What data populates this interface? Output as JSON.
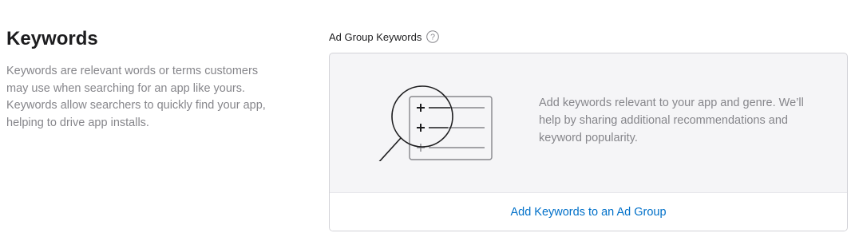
{
  "section": {
    "title": "Keywords",
    "description": "Keywords are relevant words or terms customers may use when searching for an app like yours. Keywords allow searchers to quickly find your app, helping to drive app installs."
  },
  "field": {
    "label": "Ad Group Keywords",
    "help_icon": "question-circle-icon"
  },
  "empty_state": {
    "illustration_icon": "magnifier-keyword-list-icon",
    "message": "Add keywords relevant to your app and genre. We’ll help by sharing additional recommendations and keyword popularity."
  },
  "footer": {
    "link_label": "Add Keywords to an Ad Group"
  },
  "colors": {
    "accent": "#0070c9",
    "muted_text": "#86868b",
    "card_bg": "#f5f5f7",
    "border": "#d2d2d7"
  }
}
